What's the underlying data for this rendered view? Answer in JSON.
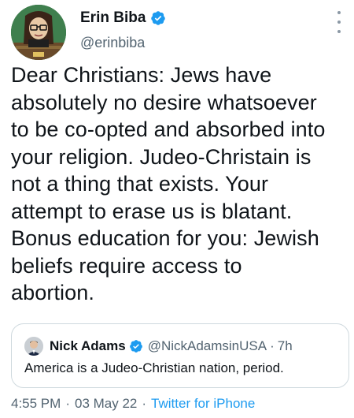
{
  "author": {
    "display_name": "Erin Biba",
    "handle": "@erinbiba",
    "verified": true,
    "avatar_icon": "cartoon-avatar",
    "more_icon": "more-vertical-icon"
  },
  "tweet": {
    "lines": [
      "Dear Christians: Jews have",
      "absolutely no desire whatsoever",
      "to be co-opted and absorbed into",
      "your religion. Judeo-Christain is",
      "not a thing that exists. Your",
      "attempt to erase us is blatant.",
      "Bonus education for you: Jewish",
      "beliefs require access to",
      "abortion."
    ]
  },
  "quoted_tweet": {
    "display_name": "Nick Adams",
    "handle": "@NickAdamsinUSA",
    "separator": "·",
    "time": "7h",
    "verified": true,
    "text": "America is a Judeo-Christian nation, period."
  },
  "meta": {
    "time": "4:55 PM",
    "separator": "·",
    "date": "03 May 22",
    "source": "Twitter for iPhone"
  },
  "colors": {
    "verified_blue": "#1d9bf0",
    "text_primary": "#0f1419",
    "text_secondary": "#536471",
    "border": "#cfd9de"
  }
}
